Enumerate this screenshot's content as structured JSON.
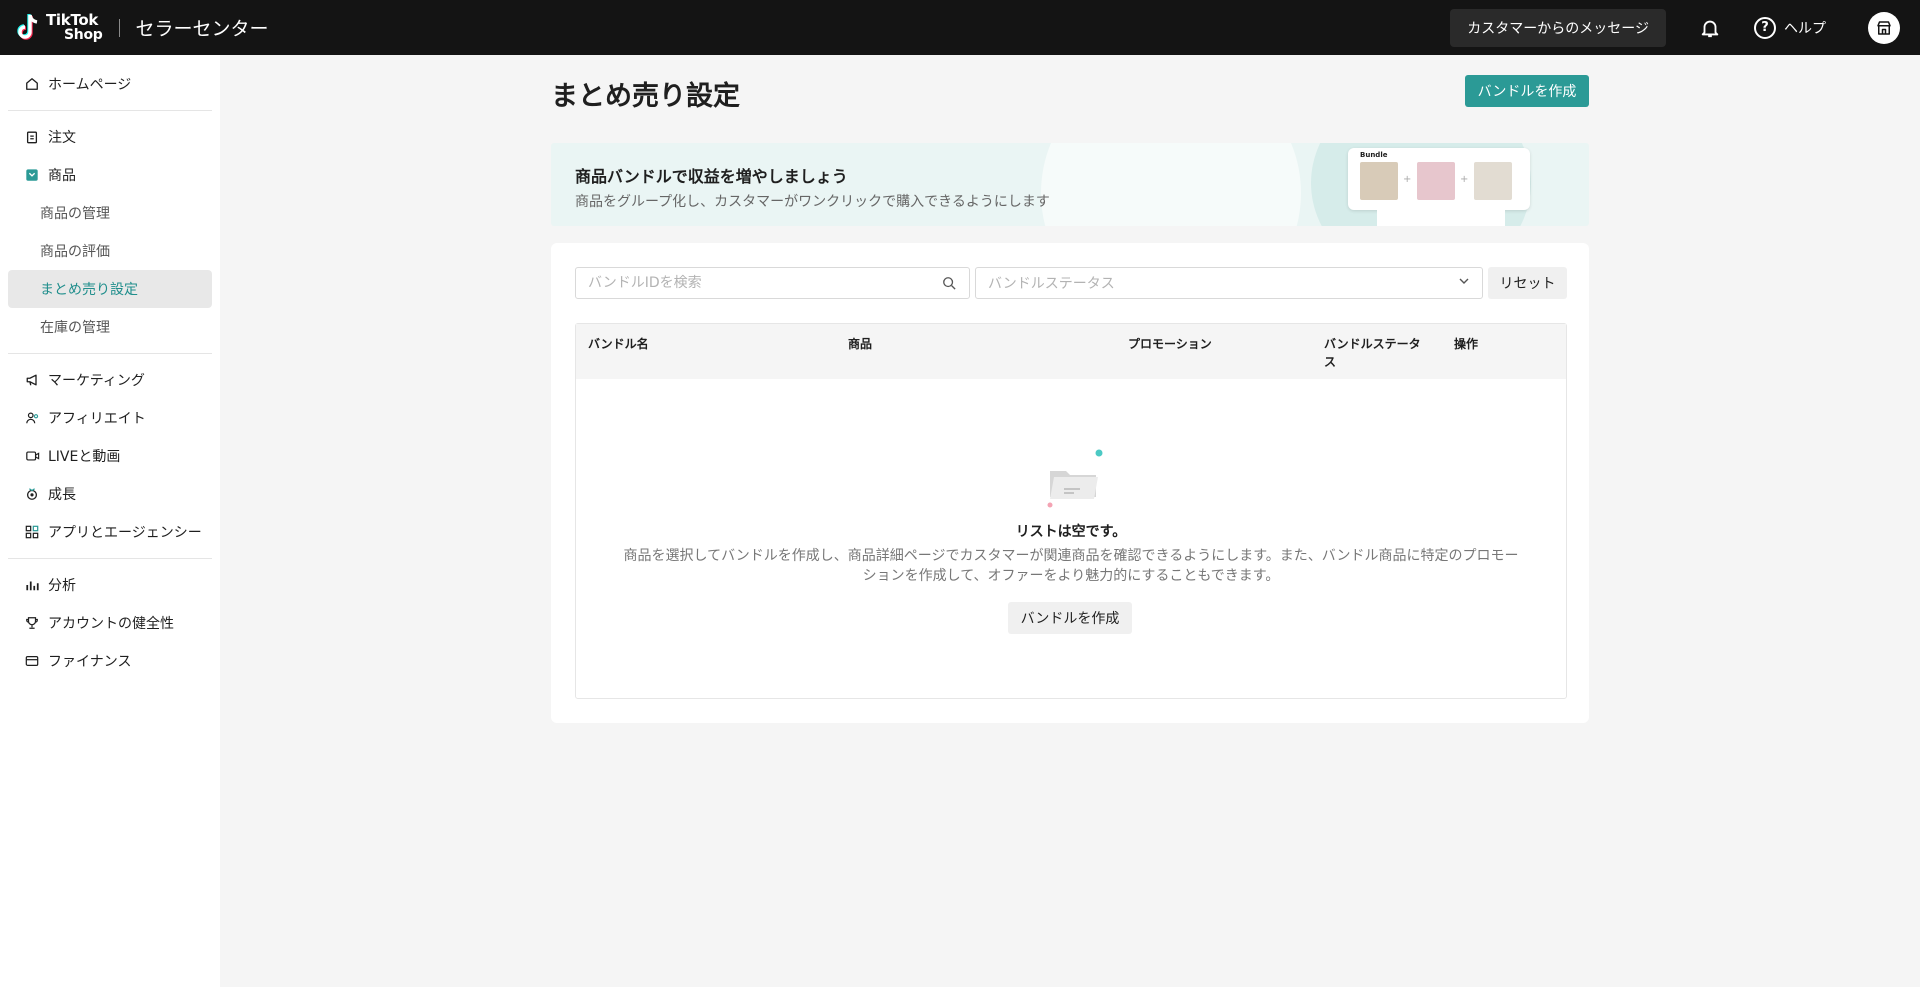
{
  "header": {
    "logo_line1": "TikTok",
    "logo_line2": "Shop",
    "app_title": "セラーセンター",
    "messages_label": "カスタマーからのメッセージ",
    "help_label": "ヘルプ"
  },
  "sidebar": {
    "items": [
      {
        "label": "ホームページ",
        "icon": "home-icon"
      },
      {
        "label": "注文",
        "icon": "clipboard-icon"
      },
      {
        "label": "商品",
        "icon": "product-icon"
      },
      {
        "label": "商品の管理"
      },
      {
        "label": "商品の評価"
      },
      {
        "label": "まとめ売り設定",
        "active": true
      },
      {
        "label": "在庫の管理"
      },
      {
        "label": "マーケティング",
        "icon": "megaphone-icon"
      },
      {
        "label": "アフィリエイト",
        "icon": "people-icon"
      },
      {
        "label": "LIVEと動画",
        "icon": "video-icon"
      },
      {
        "label": "成長",
        "icon": "medal-icon"
      },
      {
        "label": "アプリとエージェンシー",
        "icon": "apps-icon"
      },
      {
        "label": "分析",
        "icon": "chart-icon"
      },
      {
        "label": "アカウントの健全性",
        "icon": "trophy-icon"
      },
      {
        "label": "ファイナンス",
        "icon": "wallet-icon"
      }
    ]
  },
  "main": {
    "title": "まとめ売り設定",
    "create_button": "バンドルを作成",
    "banner": {
      "title": "商品バンドルで収益を増やしましょう",
      "subtitle": "商品をグループ化し、カスタマーがワンクリックで購入できるようにします",
      "card_title": "Bundle"
    },
    "filters": {
      "search_placeholder": "バンドルIDを検索",
      "status_placeholder": "バンドルステータス",
      "reset_label": "リセット"
    },
    "table": {
      "columns": [
        "バンドル名",
        "商品",
        "プロモーション",
        "バンドルステータス",
        "操作"
      ]
    },
    "empty": {
      "title": "リストは空です。",
      "description": "商品を選択してバンドルを作成し、商品詳細ページでカスタマーが関連商品を確認できるようにします。また、バンドル商品に特定のプロモーションを作成して、オファーをより魅力的にすることもできます。",
      "button": "バンドルを作成"
    }
  },
  "colors": {
    "accent": "#2b9a96",
    "active_text": "#1f8e8c",
    "topbar_bg": "#141414"
  }
}
